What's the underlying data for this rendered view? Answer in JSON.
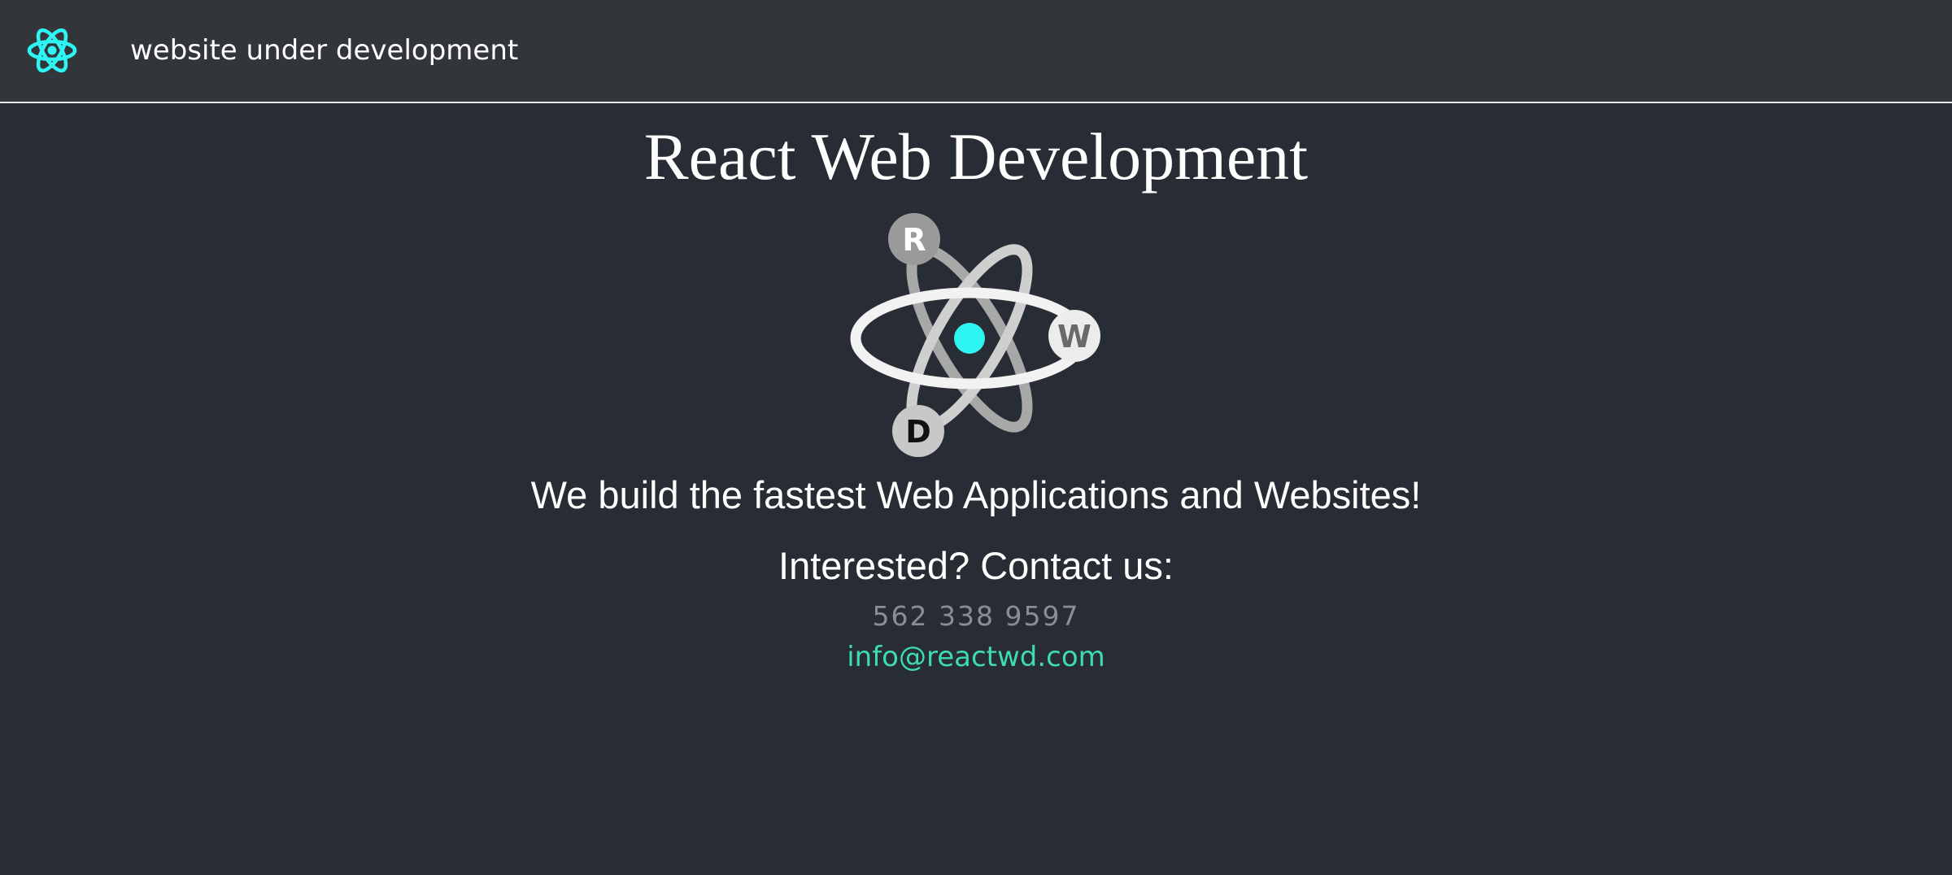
{
  "header": {
    "title": "website under development",
    "logo_icon": "react-atom-icon",
    "logo_color": "#2ff4f4"
  },
  "main": {
    "title": "React Web Development",
    "hero_logo": {
      "icon": "rwd-atom-logo-icon",
      "letters": [
        "R",
        "W",
        "D"
      ],
      "nucleus_color": "#2ff4f4"
    },
    "tagline": "We build the fastest Web Applications and Websites!",
    "contact_heading": "Interested? Contact us:",
    "phone": "562 338 9597",
    "email": "info@reactwd.com"
  },
  "colors": {
    "background": "#282c34",
    "header_background": "#32363b",
    "text": "#ffffff",
    "phone_text": "#8a8e93",
    "link": "#3ddbb0"
  }
}
